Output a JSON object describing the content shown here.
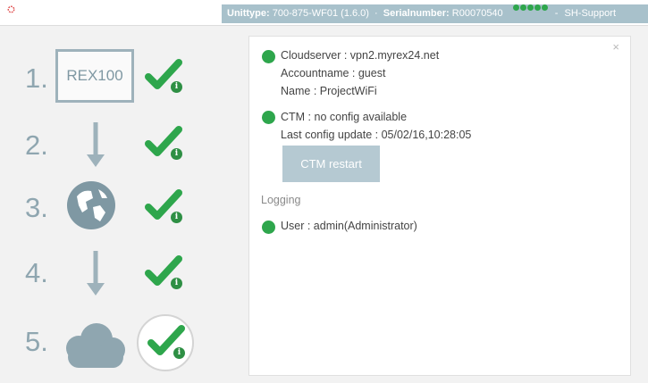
{
  "header": {
    "unit_label": "Unittype:",
    "unit_value": "700-875-WF01 (1.6.0)",
    "serial_label": "Serialnumber:",
    "serial_value": "R00070540",
    "support_label": "SH-Support",
    "status_color": "#2ea64c",
    "infobar_color": "#a8c1cb"
  },
  "steps": [
    {
      "number": "1.",
      "content": "REX100",
      "status": "ok"
    },
    {
      "number": "2.",
      "content": "arrow-down-icon",
      "status": "ok"
    },
    {
      "number": "3.",
      "content": "globe-icon",
      "status": "ok"
    },
    {
      "number": "4.",
      "content": "arrow-down-icon",
      "status": "ok"
    },
    {
      "number": "5.",
      "content": "cloud-icon",
      "status": "ok",
      "selected": true
    }
  ],
  "badge_text": "i",
  "panel": {
    "cloud": {
      "server": "Cloudserver : vpn2.myrex24.net",
      "account": "Accountname : guest",
      "name": "Name : ProjectWiFi"
    },
    "ctm": {
      "status": "CTM : no config available",
      "last_update": "Last config update : 05/02/16,10:28:05",
      "restart_label": "CTM restart"
    },
    "logging_label": "Logging",
    "user": "User : admin(Administrator)",
    "close_symbol": "×"
  },
  "colors": {
    "check": "#2ea64c",
    "step_icon": "#8fa6b0"
  }
}
